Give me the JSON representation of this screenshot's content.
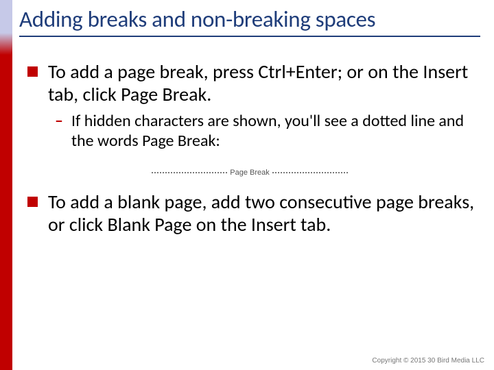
{
  "title": "Adding breaks and non-breaking spaces",
  "bullets": {
    "b1": "To add a page break, press Ctrl+Enter; or on the Insert tab, click Page Break.",
    "b1_sub": "If hidden characters are shown, you'll see a dotted line and the words Page Break:",
    "b2": "To add a blank page, add two consecutive page breaks, or click Blank Page on the Insert tab."
  },
  "page_break_label": "Page Break",
  "copyright": "Copyright © 2015 30 Bird Media LLC"
}
